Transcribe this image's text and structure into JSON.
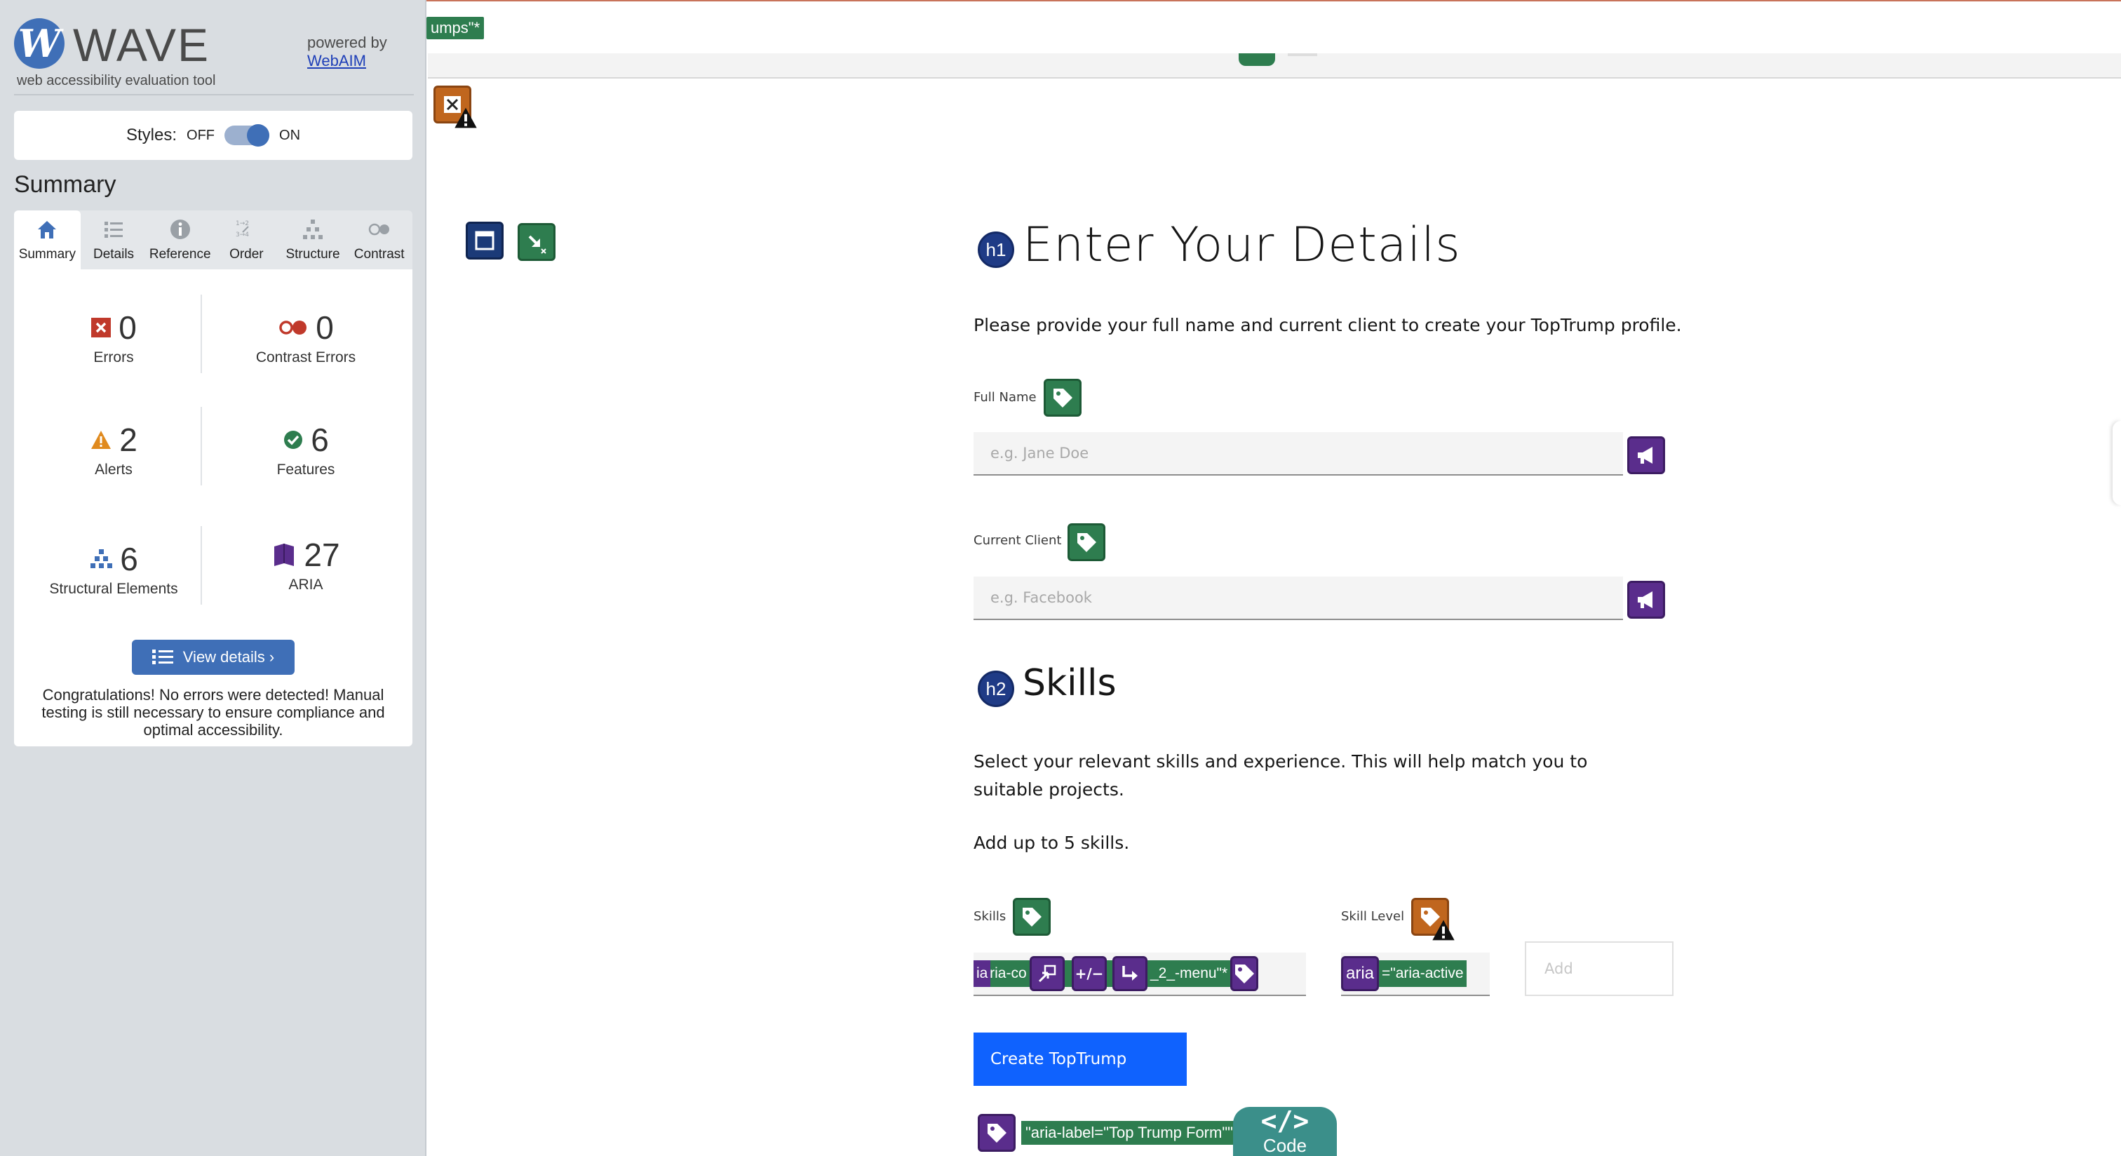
{
  "wave": {
    "logo_letter": "W",
    "logo_word": "WAVE",
    "tagline": "web accessibility evaluation tool",
    "powered_by": "powered by",
    "webaim_link": "WebAIM",
    "styles_label": "Styles:",
    "styles_off": "OFF",
    "styles_on": "ON",
    "summary_title": "Summary",
    "tabs": [
      {
        "label": "Summary",
        "icon": "home-icon"
      },
      {
        "label": "Details",
        "icon": "list-icon"
      },
      {
        "label": "Reference",
        "icon": "info-icon"
      },
      {
        "label": "Order",
        "icon": "order-icon"
      },
      {
        "label": "Structure",
        "icon": "structure-icon"
      },
      {
        "label": "Contrast",
        "icon": "contrast-icon"
      }
    ],
    "stats": {
      "errors": {
        "value": "0",
        "label": "Errors"
      },
      "contrast_errors": {
        "value": "0",
        "label": "Contrast Errors"
      },
      "alerts": {
        "value": "2",
        "label": "Alerts"
      },
      "features": {
        "value": "6",
        "label": "Features"
      },
      "structural": {
        "value": "6",
        "label": "Structural Elements"
      },
      "aria": {
        "value": "27",
        "label": "ARIA"
      }
    },
    "view_details": "View details ›",
    "congrats": "Congratulations! No errors were detected! Manual testing is still necessary to ensure compliance and optimal accessibility.",
    "colors": {
      "accent": "#3f6fb7",
      "error": "#c0392b",
      "alert": "#e08a1e",
      "feature": "#2e7d4f",
      "aria": "#5a2d8c"
    }
  },
  "page": {
    "top_fragment": "umps\"*",
    "h1_badge": "h1",
    "title": "Enter Your Details",
    "intro": "Please provide your full name and current client to create your TopTrump profile.",
    "full_name_label": "Full Name",
    "full_name_placeholder": "e.g. Jane Doe",
    "client_label": "Current Client",
    "client_placeholder": "e.g. Facebook",
    "h2_badge": "h2",
    "skills_heading": "Skills",
    "skills_text": "Select your relevant skills and experience. This will help match you to suitable projects.",
    "skills_limit": "Add up to 5 skills.",
    "skills_label": "Skills",
    "skill_level_label": "Skill Level",
    "skills_strip": [
      "ia",
      "\"aria-co",
      "+/−",
      "_2_-menu\"*"
    ],
    "level_strip": [
      "aria",
      "aria",
      "=\"aria-active"
    ],
    "add_placeholder": "Add",
    "create_button": "Create TopTrump",
    "aria_label_fragment": "\"aria-label=\"Top Trump Form\"\"",
    "code_glyph": "</>",
    "code_label": "Code"
  }
}
